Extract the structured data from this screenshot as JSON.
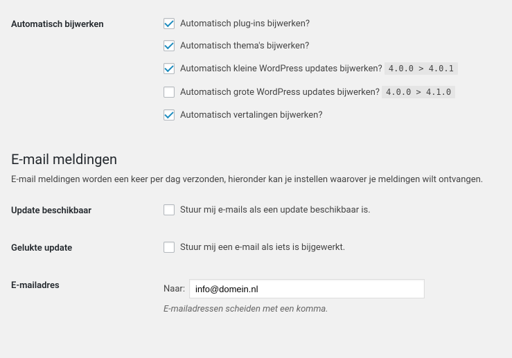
{
  "auto_update": {
    "label": "Automatisch bijwerken",
    "items": [
      {
        "label": "Automatisch plug-ins bijwerken?",
        "checked": true
      },
      {
        "label": "Automatisch thema's bijwerken?",
        "checked": true
      },
      {
        "label": "Automatisch kleine WordPress updates bijwerken?",
        "checked": true,
        "code": "4.0.0 > 4.0.1"
      },
      {
        "label": "Automatisch grote WordPress updates bijwerken?",
        "checked": false,
        "code": "4.0.0 > 4.1.0"
      },
      {
        "label": "Automatisch vertalingen bijwerken?",
        "checked": true
      }
    ]
  },
  "email_section": {
    "heading": "E-mail meldingen",
    "description": "E-mail meldingen worden een keer per dag verzonden, hieronder kan je instellen waarover je meldingen wilt ontvangen."
  },
  "update_available": {
    "label": "Update beschikbaar",
    "checkbox_label": "Stuur mij e-mails als een update beschikbaar is.",
    "checked": false
  },
  "success_update": {
    "label": "Gelukte update",
    "checkbox_label": "Stuur mij een e-mail als iets is bijgewerkt.",
    "checked": false
  },
  "email_address": {
    "label": "E-mailadres",
    "to_label": "Naar:",
    "value": "info@domein.nl",
    "hint": "E-mailadressen scheiden met een komma."
  }
}
